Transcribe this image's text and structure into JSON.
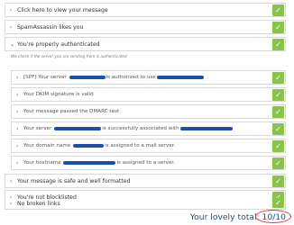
{
  "sections": [
    {
      "label": "Click here to view your message",
      "chevron": "›"
    },
    {
      "label": "SpamAssassin likes you",
      "chevron": "›"
    },
    {
      "label": "You're properly authenticated",
      "chevron": "⌄"
    }
  ],
  "auth_note": "We check if the server you are sending from is authenticated",
  "auth_items": [
    {
      "pre": "[SPF] Your server",
      "mid": "is authorized to use",
      "post": ""
    },
    {
      "pre": "Your DKIM signature is valid",
      "mid": "",
      "post": ""
    },
    {
      "pre": "Your message passed the DMARC test",
      "mid": "",
      "post": ""
    },
    {
      "pre": "Your server",
      "mid": "is successfully associated with",
      "post": ""
    },
    {
      "pre": "Your domain name",
      "mid": "is assigned to a mail server.",
      "post": ""
    },
    {
      "pre": "Your hostname",
      "mid": "is assigned to a server.",
      "post": ""
    }
  ],
  "bottom_sections": [
    {
      "label": "Your message is safe and well formatted",
      "chevron": "›"
    },
    {
      "label": "You're not blocklisted",
      "chevron": "›"
    },
    {
      "label": "No broken links",
      "chevron": "›"
    }
  ],
  "total": {
    "prefix": "Your lovely ",
    "label": "total: 10/10"
  },
  "icons": {
    "check": "check-icon",
    "chevron": "chevron-icon"
  },
  "colors": {
    "check_bg": "#8bc34a",
    "total_text": "#1a4e8f",
    "redaction": "#1e4fa8",
    "circle": "#dd3333"
  }
}
